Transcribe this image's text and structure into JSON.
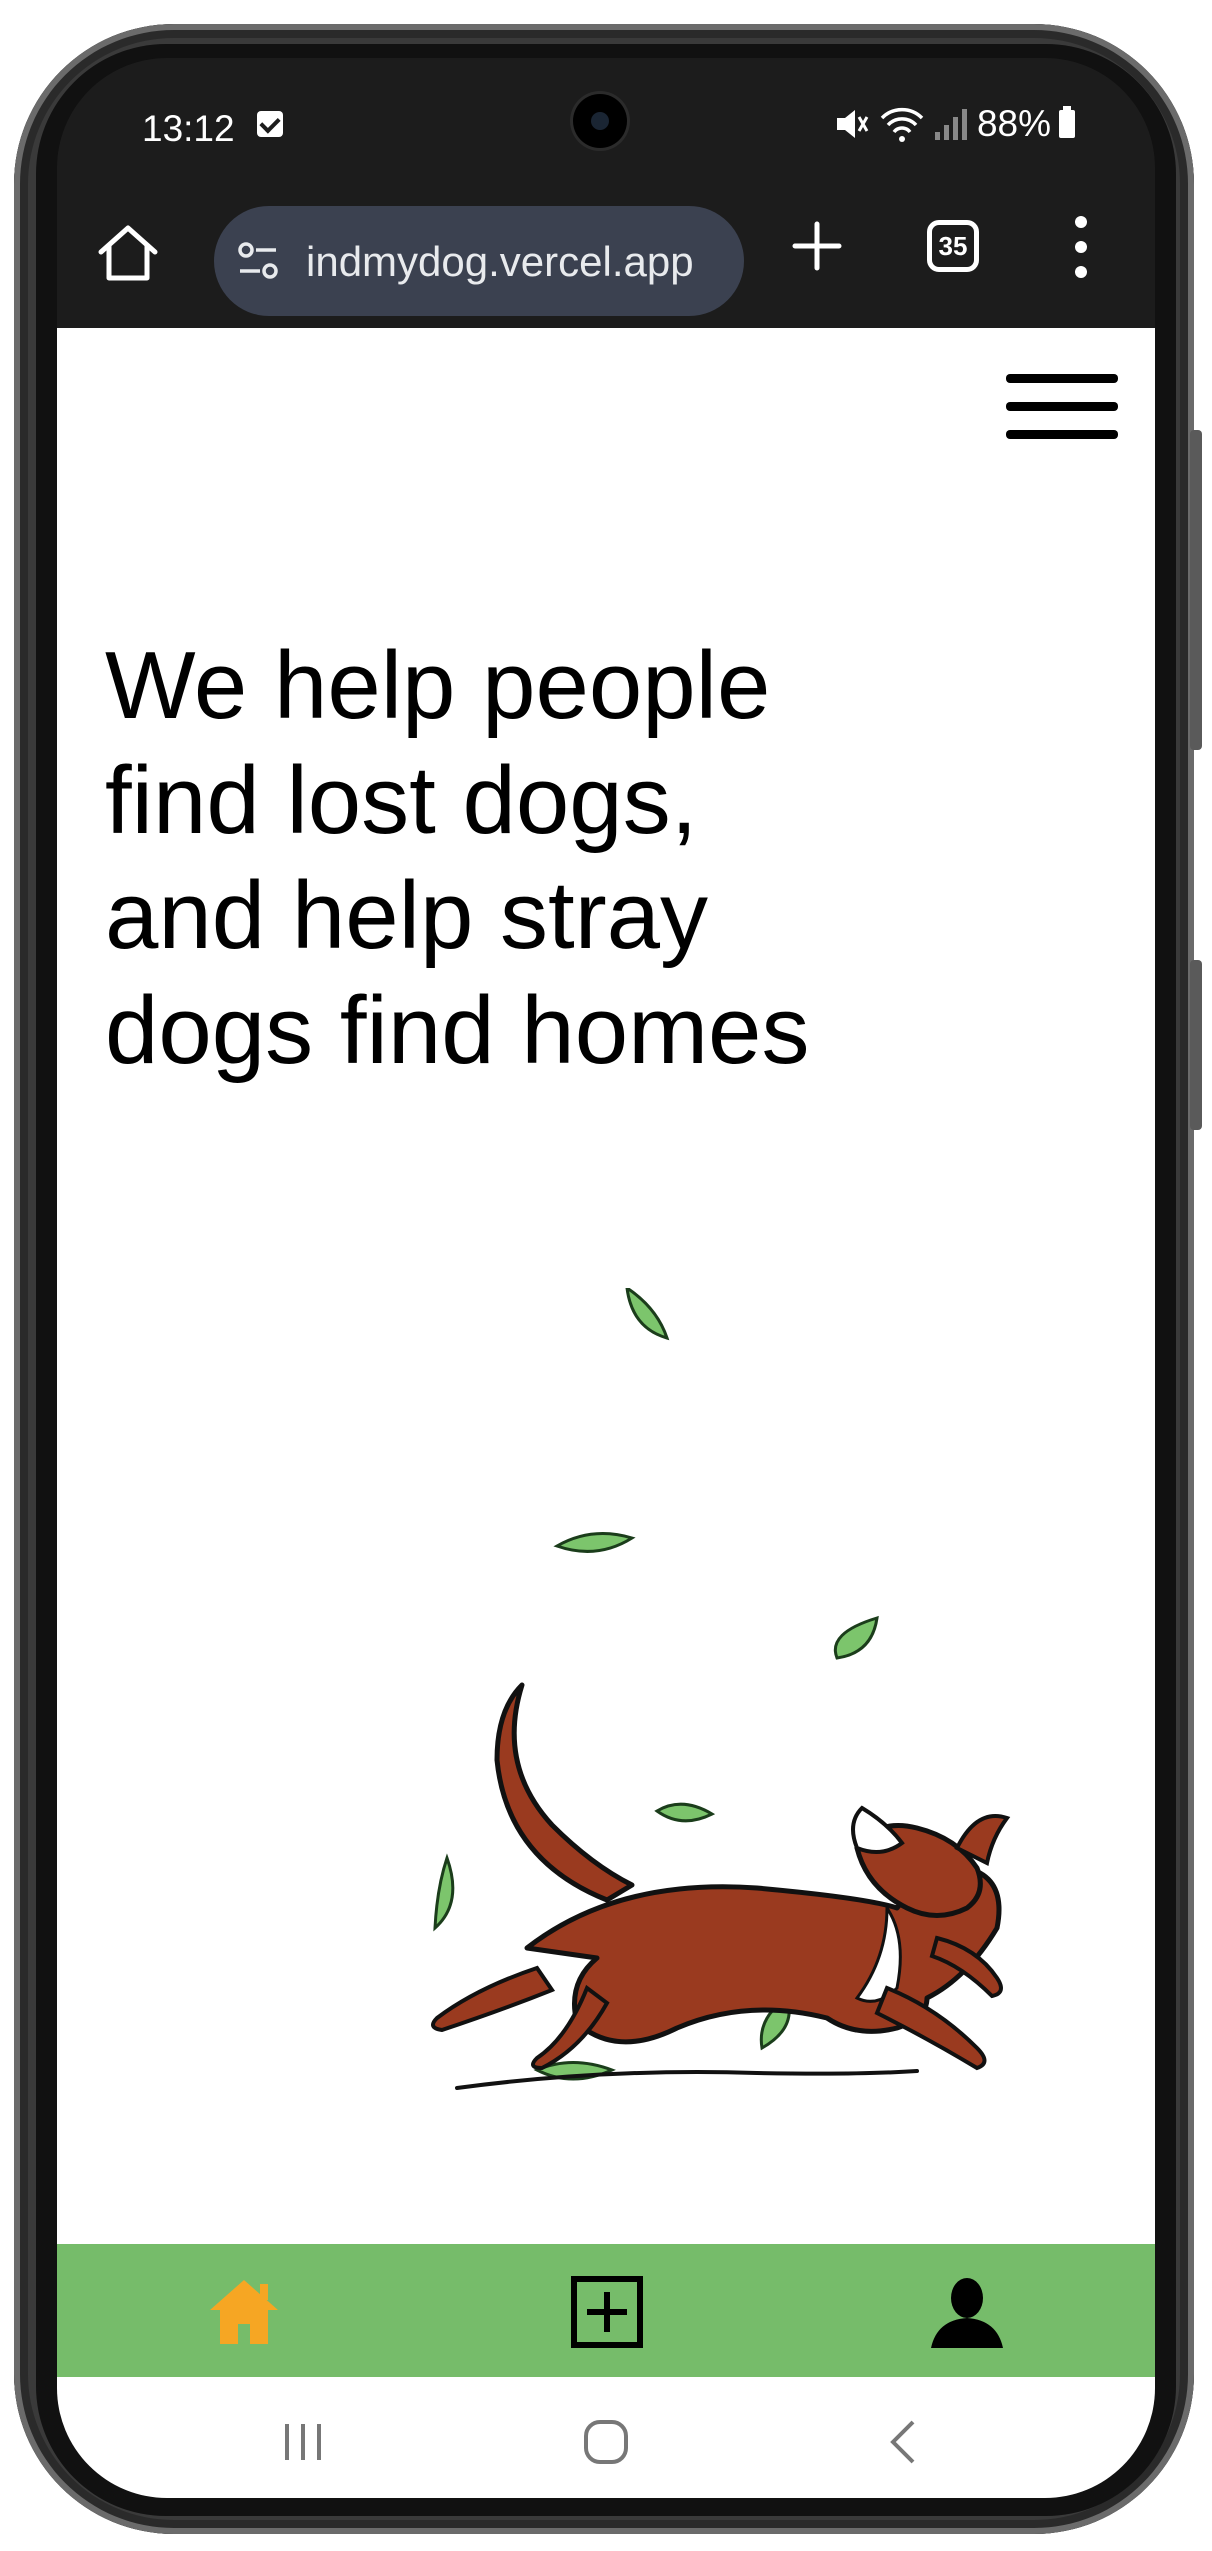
{
  "status_bar": {
    "time": "13:12",
    "battery_percent": "88%"
  },
  "browser": {
    "url": "indmydog.vercel.app",
    "tab_count": "35"
  },
  "page": {
    "headline_lines": [
      "We help people",
      "find lost dogs,",
      "and help stray",
      "dogs find homes"
    ]
  },
  "bottom_nav": {
    "color": "#76bc6a",
    "active_color": "#f6a623",
    "items": [
      {
        "icon": "home-icon",
        "active": true
      },
      {
        "icon": "add-box-icon",
        "active": false
      },
      {
        "icon": "user-icon",
        "active": false
      }
    ]
  },
  "system_nav": {
    "buttons": [
      "recent-apps-icon",
      "home-circle-icon",
      "back-icon"
    ]
  }
}
